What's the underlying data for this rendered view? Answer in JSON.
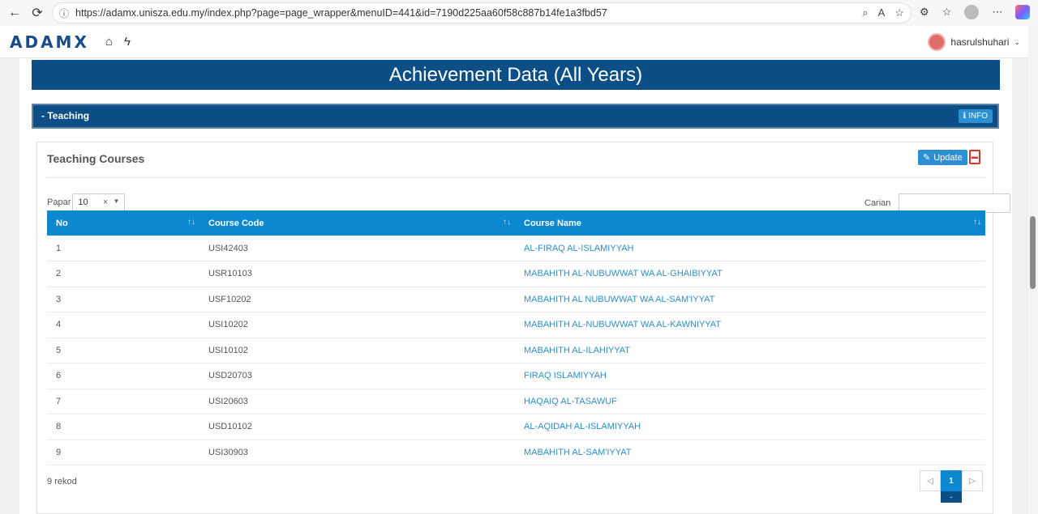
{
  "browser": {
    "url": "https://adamx.unisza.edu.my/index.php?page=page_wrapper&menuID=441&id=7190d225aa60f58c887b14fe1a3fbd57"
  },
  "app": {
    "logo": "ADAMX",
    "user_name": "hasrulshuhari"
  },
  "page": {
    "title": "Achievement Data (All Years)",
    "section": {
      "label": "- Teaching",
      "info_label": "INFO"
    },
    "card": {
      "title": "Teaching Courses",
      "update_label": "Update",
      "papar_label": "Papar",
      "papar_value": "10",
      "carian_label": "Carian",
      "columns": [
        "No",
        "Course Code",
        "Course Name"
      ],
      "rows": [
        {
          "no": "1",
          "code": "USI42403",
          "name": "AL-FIRAQ AL-ISLAMIYYAH"
        },
        {
          "no": "2",
          "code": "USR10103",
          "name": "MABAHITH AL-NUBUWWAT WA AL-GHAIBIYYAT"
        },
        {
          "no": "3",
          "code": "USF10202",
          "name": "MABAHITH AL NUBUWWAT WA AL-SAM'IYYAT"
        },
        {
          "no": "4",
          "code": "USI10202",
          "name": "MABAHITH AL-NUBUWWAT WA AL-KAWNIYYAT"
        },
        {
          "no": "5",
          "code": "USI10102",
          "name": "MABAHITH AL-ILAHIYYAT"
        },
        {
          "no": "6",
          "code": "USD20703",
          "name": "FIRAQ ISLAMIYYAH"
        },
        {
          "no": "7",
          "code": "USI20603",
          "name": "HAQAIQ AL-TASAWUF"
        },
        {
          "no": "8",
          "code": "USD10102",
          "name": "AL-AQIDAH AL-ISLAMIYYAH"
        },
        {
          "no": "9",
          "code": "USI30903",
          "name": "MABAHITH AL-SAM'IYYAT"
        }
      ],
      "record_count": "9 rekod",
      "pagination": {
        "prev": "◁",
        "current": "1",
        "next": "▷",
        "tip": "-"
      }
    }
  },
  "colors": {
    "primary_dark": "#0b4f86",
    "table_header": "#0b88d0",
    "link": "#2b8fd0"
  }
}
